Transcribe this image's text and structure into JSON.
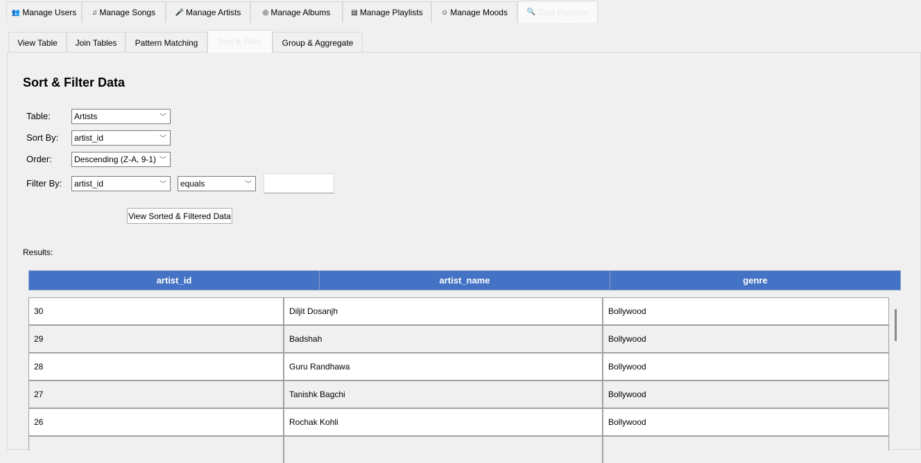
{
  "main_tabs": [
    {
      "label": "Manage Users",
      "icon": "users-icon",
      "glyph": "👥"
    },
    {
      "label": "Manage Songs",
      "icon": "music-note-icon",
      "glyph": "♫"
    },
    {
      "label": "Manage Artists",
      "icon": "microphone-icon",
      "glyph": "🎤"
    },
    {
      "label": "Manage Albums",
      "icon": "disc-icon",
      "glyph": "◎"
    },
    {
      "label": "Manage Playlists",
      "icon": "playlist-icon",
      "glyph": "▤"
    },
    {
      "label": "Manage Moods",
      "icon": "mood-icon",
      "glyph": "☺"
    },
    {
      "label": "Data Explorer",
      "icon": "search-icon",
      "glyph": "🔍",
      "selected": true
    }
  ],
  "sub_tabs": [
    {
      "label": "View Table"
    },
    {
      "label": "Join Tables"
    },
    {
      "label": "Pattern Matching"
    },
    {
      "label": "Sort & Filter",
      "selected": true
    },
    {
      "label": "Group & Aggregate"
    }
  ],
  "form": {
    "title": "Sort & Filter Data",
    "table_label": "Table:",
    "table_value": "Artists",
    "sort_label": "Sort By:",
    "sort_value": "artist_id",
    "order_label": "Order:",
    "order_value": "Descending (Z-A, 9-1)",
    "filter_label": "Filter By:",
    "filter_column": "artist_id",
    "filter_op": "equals",
    "filter_value": "",
    "submit_label": "View Sorted & Filtered Data"
  },
  "results": {
    "label": "Results:",
    "columns": [
      "artist_id",
      "artist_name",
      "genre"
    ],
    "rows": [
      [
        "30",
        "Diljit Dosanjh",
        "Bollywood"
      ],
      [
        "29",
        "Badshah",
        "Bollywood"
      ],
      [
        "28",
        "Guru Randhawa",
        "Bollywood"
      ],
      [
        "27",
        "Tanishk Bagchi",
        "Bollywood"
      ],
      [
        "26",
        "Rochak Kohli",
        "Bollywood"
      ],
      [
        "",
        "",
        ""
      ]
    ]
  },
  "colors": {
    "header": "#4472c4",
    "row_alt": "#f0f0f0"
  }
}
